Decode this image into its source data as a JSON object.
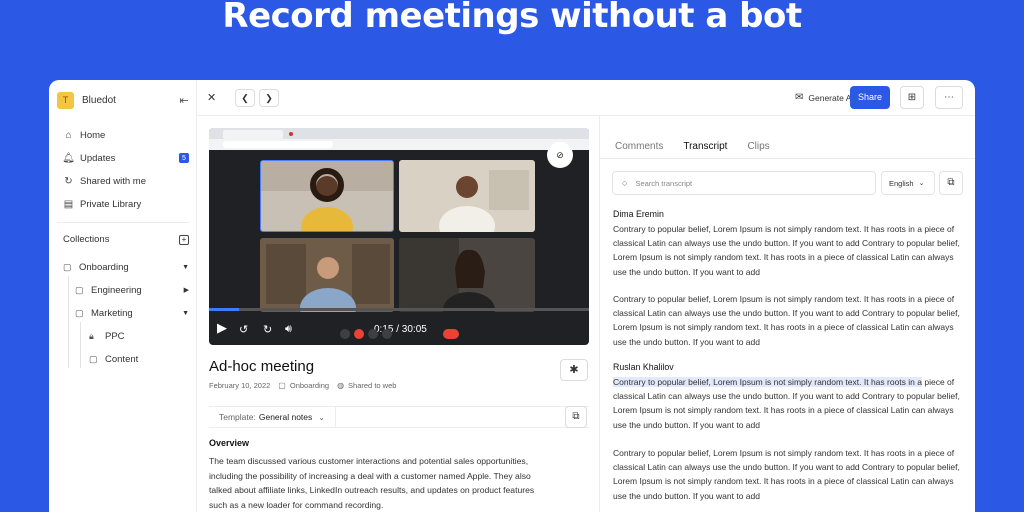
{
  "hero": {
    "title": "Record meetings without a bot"
  },
  "sidebar": {
    "workspace_initial": "T",
    "workspace_name": "Bluedot",
    "nav": [
      {
        "label": "Home"
      },
      {
        "label": "Updates",
        "badge": "5"
      },
      {
        "label": "Shared with me"
      },
      {
        "label": "Private Library"
      }
    ],
    "collections_label": "Collections",
    "tree": [
      {
        "label": "Onboarding"
      },
      {
        "label": "Engineering"
      },
      {
        "label": "Marketing"
      },
      {
        "label": "PPC"
      },
      {
        "label": "Content"
      }
    ]
  },
  "topbar": {
    "generate_ai_email": "Generate AI email",
    "share": "Share"
  },
  "video": {
    "time": "0:15 / 30:05",
    "progress": 0.008
  },
  "meeting": {
    "title": "Ad-hoc meeting",
    "date": "February 10, 2022",
    "collection": "Onboarding",
    "visibility": "Shared to web",
    "template_prefix": "Template:",
    "template_value": "General notes",
    "overview_heading": "Overview",
    "overview_body": "The team discussed various customer interactions and potential sales opportunities, including the possibility of increasing a deal with a customer named Apple. They also talked about affiliate links, LinkedIn outreach results, and updates on product features such as a new loader for command recording."
  },
  "panel": {
    "tabs": [
      "Comments",
      "Transcript",
      "Clips"
    ],
    "active_tab": "Transcript",
    "search_placeholder": "Search transcript",
    "language": "English"
  },
  "transcript": {
    "speaker1": "Dima Eremin",
    "p1": "Contrary to popular belief, Lorem Ipsum is not simply random text. It has roots in a piece of classical Latin can always use the undo button. If you want to add Contrary to popular belief, Lorem Ipsum is not simply random text. It has roots in a piece of classical Latin can always use the undo button. If you want to add",
    "p2": "Contrary to popular belief, Lorem Ipsum is not simply random text. It has roots in a piece of classical Latin can always use the undo button. If you want to add Contrary to popular belief, Lorem Ipsum is not simply random text. It has roots in a piece of classical Latin can always use the undo button. If you want to add",
    "speaker2": "Ruslan Khalilov",
    "p3_highlight": "Contrary to popular belief, Lorem Ipsum is not simply random text. It has roots in a",
    "p3_rest": " piece of classical Latin can always use the undo button. If you want to add Contrary to popular belief, Lorem Ipsum is not simply random text. It has roots in a piece of classical Latin can always use the undo button. If you want to add",
    "p4": "Contrary to popular belief, Lorem Ipsum is not simply random text. It has roots in a piece of classical Latin can always use the undo button. If you want to add Contrary to popular belief, Lorem Ipsum is not simply random text. It has roots in a piece of classical Latin can always use the undo button. If you want to add"
  }
}
